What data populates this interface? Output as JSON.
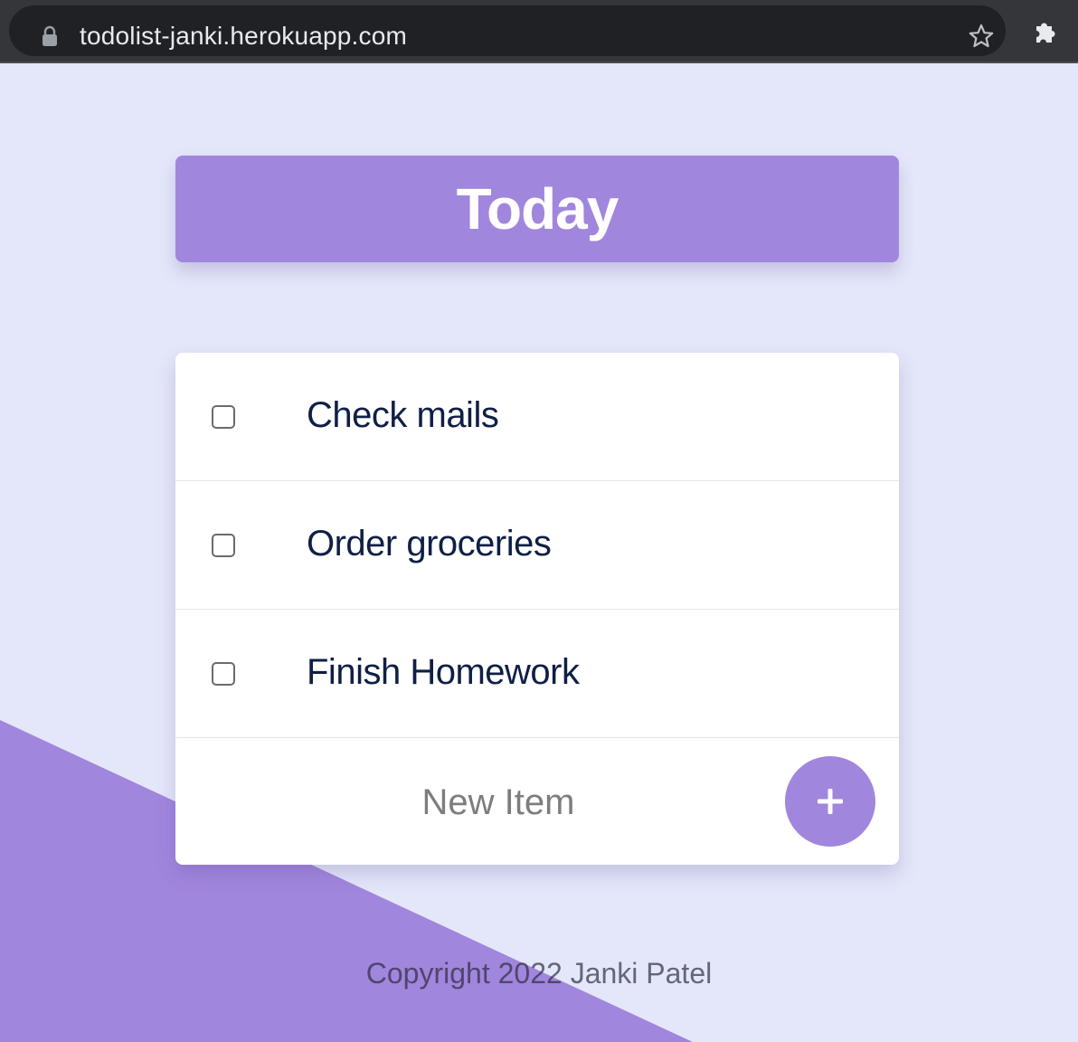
{
  "browser": {
    "url": "todolist-janki.herokuapp.com",
    "lock_icon": "lock-icon",
    "star_icon": "star-icon",
    "extensions_icon": "puzzle-icon"
  },
  "heading": {
    "title": "Today"
  },
  "todo": {
    "items": [
      {
        "label": "Check mails",
        "checked": false
      },
      {
        "label": "Order groceries",
        "checked": false
      },
      {
        "label": "Finish Homework",
        "checked": false
      }
    ],
    "new_item_placeholder": "New Item",
    "add_button_symbol": "+"
  },
  "footer": {
    "text": "Copyright 2022 Janki Patel"
  },
  "colors": {
    "background": "#e4e7fa",
    "accent": "#a186dd",
    "card": "#ffffff",
    "item_text": "#0f1f45"
  }
}
